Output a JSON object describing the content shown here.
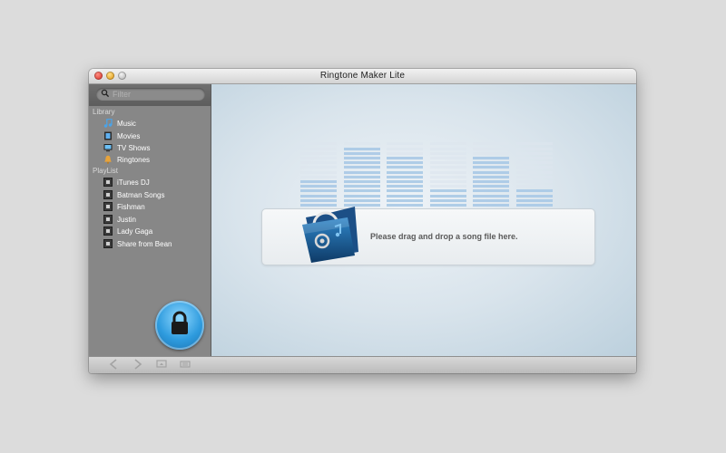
{
  "window": {
    "title": "Ringtone Maker Lite"
  },
  "search": {
    "placeholder": "Filter"
  },
  "sidebar": {
    "library_label": "Library",
    "library_items": [
      {
        "label": "Music",
        "icon": "music-note-icon"
      },
      {
        "label": "Movies",
        "icon": "film-icon"
      },
      {
        "label": "TV Shows",
        "icon": "tv-icon"
      },
      {
        "label": "Ringtones",
        "icon": "bell-icon"
      }
    ],
    "playlist_label": "PlayList",
    "playlist_items": [
      {
        "label": "iTunes DJ"
      },
      {
        "label": "Batman Songs"
      },
      {
        "label": "Fishman"
      },
      {
        "label": "Justin"
      },
      {
        "label": "Lady Gaga"
      },
      {
        "label": "Share from Bean"
      }
    ]
  },
  "main": {
    "drop_text": "Please drag and drop a song file here.",
    "equalizer_levels": [
      0.45,
      0.9,
      0.75,
      0.25,
      0.75,
      0.25
    ]
  },
  "colors": {
    "accent_blue": "#2e9bde",
    "sidebar_bg": "#878787",
    "eq_active": "#a8c9e6",
    "eq_inactive": "#dde6ee"
  },
  "bottom_bar": {
    "buttons": [
      "back-arrow-icon",
      "forward-arrow-icon",
      "screen-icon",
      "list-icon"
    ]
  }
}
